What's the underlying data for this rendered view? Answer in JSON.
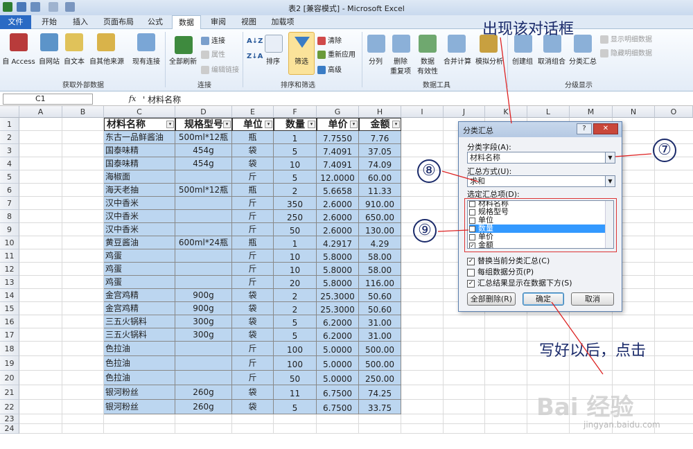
{
  "window": {
    "title": "表2 [兼容模式] - Microsoft Excel"
  },
  "tabs": [
    "文件",
    "开始",
    "插入",
    "页面布局",
    "公式",
    "数据",
    "审阅",
    "视图",
    "加载项"
  ],
  "ribbon": {
    "ext": {
      "access": "自 Access",
      "web": "自网站",
      "text": "自文本",
      "other": "自其他来源",
      "existing": "现有连接",
      "group": "获取外部数据"
    },
    "conn": {
      "refresh": "全部刷新",
      "connections": "连接",
      "props": "属性",
      "links": "编辑链接",
      "group": "连接"
    },
    "sort": {
      "sort": "排序",
      "filter": "筛选",
      "clear": "清除",
      "reapply": "重新应用",
      "advanced": "高级",
      "group": "排序和筛选"
    },
    "tools": {
      "split": "分列",
      "remove": "删除",
      "remove2": "重复项",
      "validate": "数据",
      "validate2": "有效性",
      "consolidate": "合并计算",
      "whatif": "模拟分析",
      "group": "数据工具"
    },
    "outline": {
      "group_btn": "创建组",
      "ungroup": "取消组合",
      "subtotal": "分类汇总",
      "show": "显示明细数据",
      "hide": "隐藏明细数据",
      "group": "分级显示"
    }
  },
  "formula": {
    "name": "C1",
    "fx": "fx",
    "content": "' 材料名称"
  },
  "columns": [
    "A",
    "B",
    "C",
    "D",
    "E",
    "F",
    "G",
    "H",
    "I",
    "J",
    "K",
    "L",
    "M",
    "N",
    "O"
  ],
  "rows": [
    "1",
    "2",
    "3",
    "4",
    "5",
    "6",
    "7",
    "8",
    "9",
    "10",
    "11",
    "12",
    "13",
    "14",
    "15",
    "16",
    "17",
    "18",
    "19",
    "20",
    "21",
    "22",
    "23",
    "24"
  ],
  "table": {
    "headers": [
      "材料名称",
      "规格型号",
      "单位",
      "数量",
      "单价",
      "金额"
    ],
    "rows": [
      [
        "东古一品鲜酱油",
        "500ml*12瓶",
        "瓶",
        "1",
        "7.7550",
        "7.76"
      ],
      [
        "国泰味精",
        "454g",
        "袋",
        "5",
        "7.4091",
        "37.05"
      ],
      [
        "国泰味精",
        "454g",
        "袋",
        "10",
        "7.4091",
        "74.09"
      ],
      [
        "海椒面",
        "",
        "斤",
        "5",
        "12.0000",
        "60.00"
      ],
      [
        "海天老抽",
        "500ml*12瓶",
        "瓶",
        "2",
        "5.6658",
        "11.33"
      ],
      [
        "汉中香米",
        "",
        "斤",
        "350",
        "2.6000",
        "910.00"
      ],
      [
        "汉中香米",
        "",
        "斤",
        "250",
        "2.6000",
        "650.00"
      ],
      [
        "汉中香米",
        "",
        "斤",
        "50",
        "2.6000",
        "130.00"
      ],
      [
        "黄豆酱油",
        "600ml*24瓶",
        "瓶",
        "1",
        "4.2917",
        "4.29"
      ],
      [
        "鸡蛋",
        "",
        "斤",
        "10",
        "5.8000",
        "58.00"
      ],
      [
        "鸡蛋",
        "",
        "斤",
        "10",
        "5.8000",
        "58.00"
      ],
      [
        "鸡蛋",
        "",
        "斤",
        "20",
        "5.8000",
        "116.00"
      ],
      [
        "金宫鸡精",
        "900g",
        "袋",
        "2",
        "25.3000",
        "50.60"
      ],
      [
        "金宫鸡精",
        "900g",
        "袋",
        "2",
        "25.3000",
        "50.60"
      ],
      [
        "三五火锅料",
        "300g",
        "袋",
        "5",
        "6.2000",
        "31.00"
      ],
      [
        "三五火锅料",
        "300g",
        "袋",
        "5",
        "6.2000",
        "31.00"
      ],
      [
        "色拉油",
        "",
        "斤",
        "100",
        "5.0000",
        "500.00"
      ],
      [
        "色拉油",
        "",
        "斤",
        "100",
        "5.0000",
        "500.00"
      ],
      [
        "色拉油",
        "",
        "斤",
        "50",
        "5.0000",
        "250.00"
      ],
      [
        "银河粉丝",
        "260g",
        "袋",
        "11",
        "6.7500",
        "74.25"
      ],
      [
        "银河粉丝",
        "260g",
        "袋",
        "5",
        "6.7500",
        "33.75"
      ]
    ]
  },
  "dialog": {
    "title": "分类汇总",
    "help": "?",
    "close": "✕",
    "field_label": "分类字段(A):",
    "field_value": "材料名称",
    "method_label": "汇总方式(U):",
    "method_value": "求和",
    "items_label": "选定汇总项(D):",
    "items": [
      {
        "label": "材料名称",
        "checked": false
      },
      {
        "label": "规格型号",
        "checked": false
      },
      {
        "label": "单位",
        "checked": false
      },
      {
        "label": "数量",
        "checked": true
      },
      {
        "label": "单价",
        "checked": false
      },
      {
        "label": "金额",
        "checked": true
      }
    ],
    "opt1": "替换当前分类汇总(C)",
    "opt2": "每组数据分页(P)",
    "opt3": "汇总结果显示在数据下方(S)",
    "btn_remove": "全部删除(R)",
    "btn_ok": "确定",
    "btn_cancel": "取消"
  },
  "annotations": {
    "top": "出现该对话框",
    "bottom": "写好以后，点击",
    "n7": "⑦",
    "n8": "⑧",
    "n9": "⑨"
  },
  "watermark": {
    "brand": "Bai 经验",
    "url": "jingyan.baidu.com"
  }
}
